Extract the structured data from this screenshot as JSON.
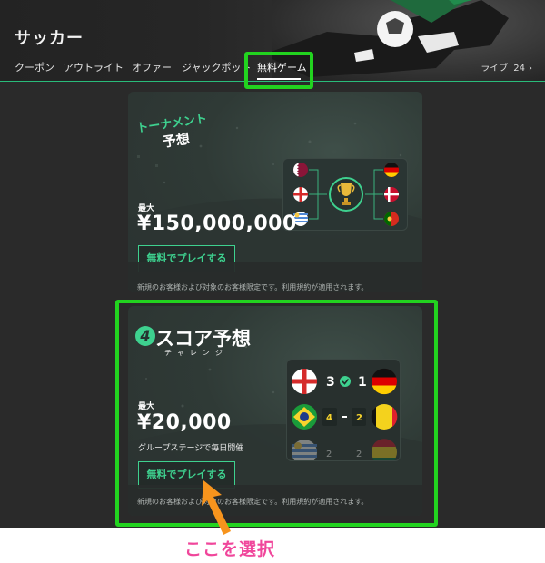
{
  "header": {
    "title": "サッカー",
    "nav": [
      {
        "label": "クーポン"
      },
      {
        "label": "アウトライト"
      },
      {
        "label": "オファー"
      },
      {
        "label": "ジャックポット"
      },
      {
        "label": "無料ゲーム",
        "active": true
      }
    ],
    "live": {
      "label": "ライブ",
      "count": "24",
      "chevron": "›"
    }
  },
  "cards": [
    {
      "logo_line1": "トーナメント",
      "logo_line2": "予想",
      "max_label": "最大",
      "prize": "¥150,000,000",
      "button": "無料でプレイする",
      "disclaimer": "新規のお客様および対象のお客様限定です。利用規約が適用されます。",
      "bracket_flags_left": [
        "qatar-flag",
        "england-flag",
        "uruguay-flag"
      ],
      "bracket_flags_right": [
        "germany-flag",
        "denmark-flag",
        "portugal-flag"
      ],
      "trophy": "trophy-icon"
    },
    {
      "logo_number": "4",
      "logo_title": "スコア予想",
      "logo_sub": "チャレンジ",
      "max_label": "最大",
      "prize": "¥20,000",
      "subtext": "グループステージで毎日開催",
      "button": "無料でプレイする",
      "disclaimer": "新規のお客様および対象のお客様限定です。利用規約が適用されます。",
      "matches": [
        {
          "home": "england-flag",
          "home_score": "3",
          "away_score": "1",
          "away": "germany-flag"
        },
        {
          "home": "brazil-flag",
          "home_score": "4",
          "away_score": "2",
          "away": "belgium-flag"
        },
        {
          "home": "uruguay-flag",
          "home_score": "2",
          "away_score": "2",
          "away": "ghana-flag"
        }
      ]
    }
  ],
  "annotation": {
    "caption": "ここを選択",
    "color": "#f0469b",
    "highlight_color": "#22d31f",
    "arrow_color": "#f7941d"
  },
  "colors": {
    "accent": "#3ed18f",
    "background": "#2a2a2a"
  }
}
